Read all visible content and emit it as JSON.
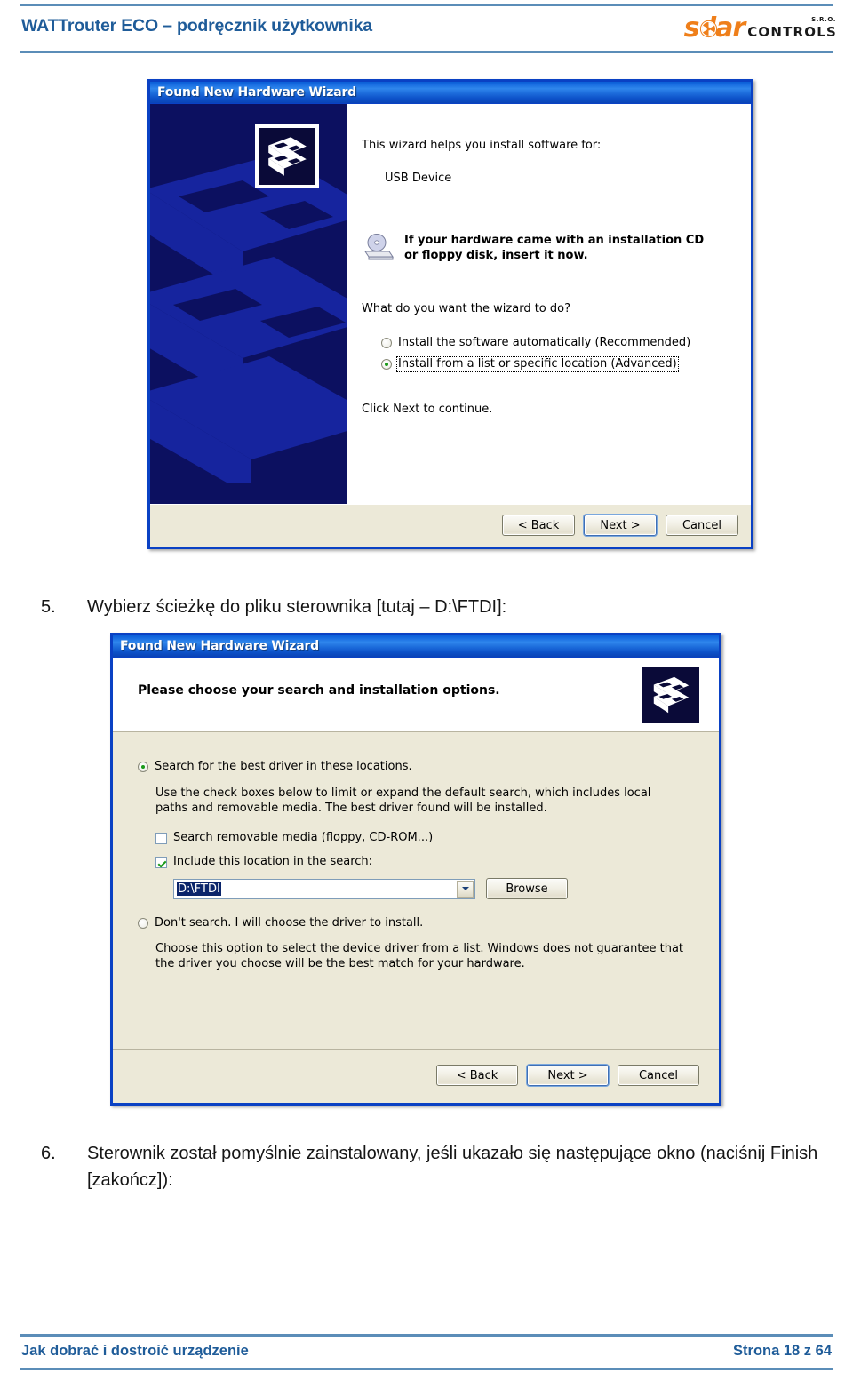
{
  "header": {
    "title": "WATTrouter ECO – podręcznik użytkownika",
    "logo": {
      "word": "s  lar",
      "sro": "S.R.O.",
      "controls": "CONTROLS",
      "accent_color": "#ef7f1a"
    }
  },
  "footer": {
    "left": "Jak dobrać i dostroić urządzenie",
    "right": "Strona 18 z 64",
    "rule_color": "#5b8db8"
  },
  "steps": [
    {
      "number": "5.",
      "text": "Wybierz ścieżkę do pliku sterownika [tutaj –  D:\\FTDI]:"
    },
    {
      "number": "6.",
      "text": "Sterownik został pomyślnie zainstalowany, jeśli ukazało się następujące okno (naciśnij Finish [zakończ]):"
    }
  ],
  "dialog1": {
    "title": "Found New Hardware Wizard",
    "intro": "This wizard helps you install software for:",
    "device": "USB Device",
    "cd_notice_line1": "If your hardware came with an installation CD",
    "cd_notice_line2": "or floppy disk, insert it now.",
    "question": "What do you want the wizard to do?",
    "options": [
      {
        "label": "Install the software automatically (Recommended)",
        "checked": false,
        "focused": false
      },
      {
        "label": "Install from a list or specific location (Advanced)",
        "checked": true,
        "focused": true
      }
    ],
    "hint": "Click Next to continue.",
    "buttons": {
      "back": "< Back",
      "next": "Next >",
      "cancel": "Cancel",
      "default": "next"
    }
  },
  "dialog2": {
    "title": "Found New Hardware Wizard",
    "heading": "Please choose your search and installation options.",
    "option_search": {
      "label": "Search for the best driver in these locations.",
      "checked": true
    },
    "search_desc_line1": "Use the check boxes below to limit or expand the default search, which includes local",
    "search_desc_line2": "paths and removable media. The best driver found will be installed.",
    "check_removable": {
      "label": "Search removable media (floppy, CD-ROM...)",
      "checked": false
    },
    "check_location": {
      "label": "Include this location in the search:",
      "checked": true
    },
    "location_value": "D:\\FTDI",
    "browse_label": "Browse",
    "option_dontsearch": {
      "label": "Don't search.  I will choose the driver to install.",
      "checked": false
    },
    "dontsearch_desc_line1": "Choose this option to select the device driver from a list.  Windows does not guarantee that",
    "dontsearch_desc_line2": "the driver you choose will be the best match for your hardware.",
    "buttons": {
      "back": "< Back",
      "next": "Next >",
      "cancel": "Cancel",
      "default": "next"
    }
  }
}
